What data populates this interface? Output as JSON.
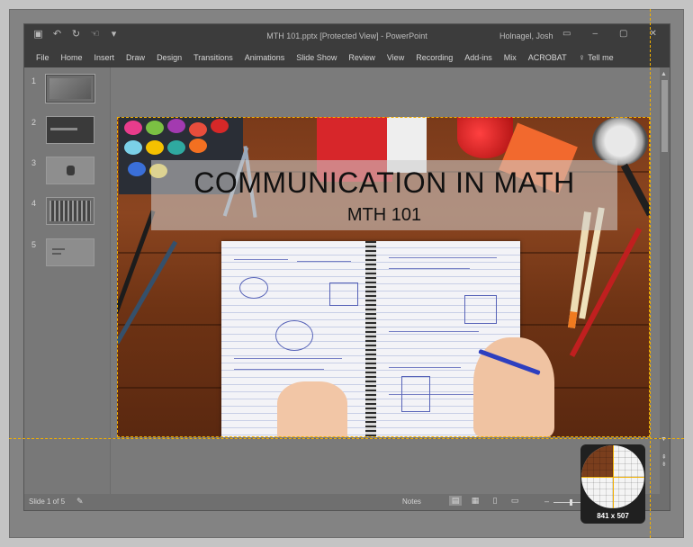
{
  "window": {
    "title": "MTH 101.pptx [Protected View]  -  PowerPoint",
    "user": "Holnagel, Josh"
  },
  "ribbon": {
    "tabs": [
      "File",
      "Home",
      "Insert",
      "Draw",
      "Design",
      "Transitions",
      "Animations",
      "Slide Show",
      "Review",
      "View",
      "Recording",
      "Add-ins",
      "Mix",
      "ACROBAT"
    ],
    "tell_me": "Tell me"
  },
  "thumbnails": [
    "1",
    "2",
    "3",
    "4",
    "5"
  ],
  "slide": {
    "title": "COMMUNICATION IN MATH",
    "subtitle": "MTH 101"
  },
  "status": {
    "slide_info": "Slide 1 of 5",
    "notes_label": "Notes"
  },
  "magnifier": {
    "dims": "841 x 507"
  },
  "colors": {
    "guide": "#f2b000",
    "chrome": "#3c3c3c"
  }
}
